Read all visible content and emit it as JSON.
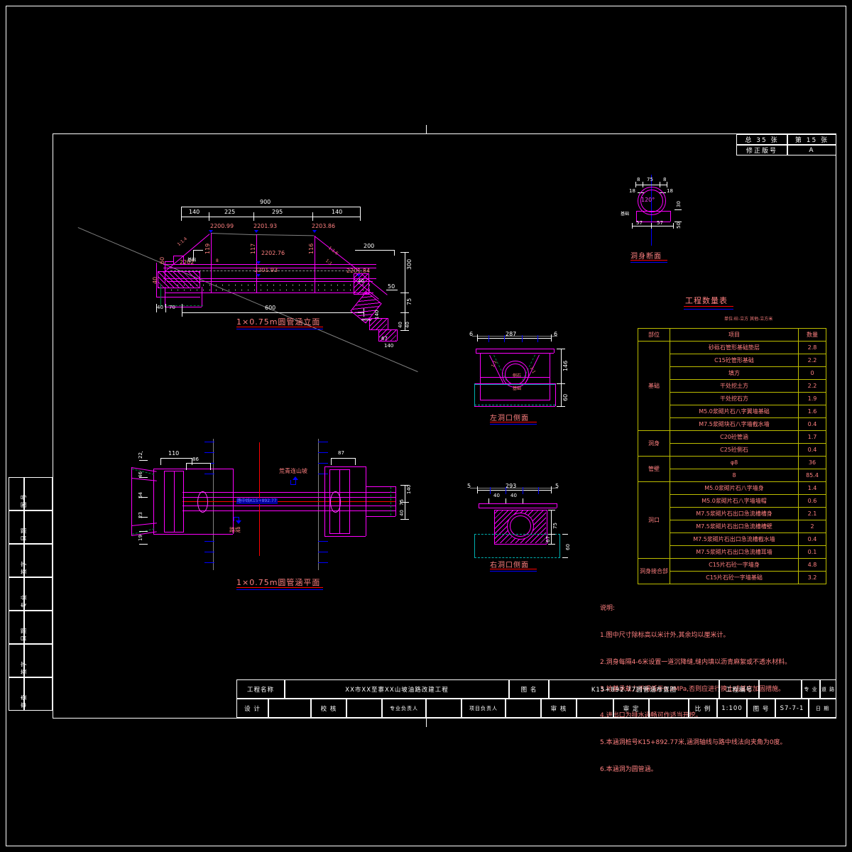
{
  "sheet": {
    "header": {
      "total_label": "总  35  张",
      "sheet_label": "第  15  张",
      "revision_label": "修正版号",
      "revision_value": "A"
    },
    "side_strip": [
      {
        "label": "图  号"
      },
      {
        "label": "日  期"
      },
      {
        "label": "签  字"
      },
      {
        "label": "专  业"
      },
      {
        "label": "日  期"
      },
      {
        "label": "签  字"
      },
      {
        "label": "审  查"
      }
    ]
  },
  "views": {
    "elevation": {
      "title": "1×0.75m圆管涵立面",
      "dims": {
        "total_top": "900",
        "seg1": "140",
        "seg2": "225",
        "seg3": "295",
        "seg4": "140",
        "bottom_total": "600",
        "left_a": "40",
        "left_b": "70",
        "left_h1": "60",
        "left_h2": "40",
        "right_200": "200",
        "right_300": "300",
        "right_50": "50",
        "right_75": "75",
        "right_40a": "40",
        "right_40b": "40",
        "right_67": "67",
        "right_140": "140",
        "right_90": "90"
      },
      "elevations": {
        "e1": "2200.99",
        "e2": "2201.93",
        "e3": "2203.86",
        "e4": "2202.76",
        "e5": "2201.93",
        "e6": "2202",
        "e7": "2201.84"
      },
      "heights": {
        "h1": "119",
        "h2": "117",
        "h3": "116"
      },
      "slopes": {
        "s1": "1:1.4",
        "s2": "1:1.6",
        "s3": "1:1"
      }
    },
    "plan": {
      "title": "1×0.75m圆管涵平面",
      "dims": {
        "d110": "110",
        "d86": "86",
        "d87": "87",
        "d22": "22",
        "d46": "46",
        "d54": "54",
        "d23": "23",
        "d19": "19",
        "r140a": "140",
        "r75": "75",
        "r40": "40"
      },
      "labels": {
        "uphill": "荒青连山坡",
        "downhill": "路堤",
        "centerline": "路中线K15+892.77"
      }
    },
    "left_inlet": {
      "title": "左洞口侧面",
      "dims": {
        "w": "287",
        "l6a": "6",
        "l6b": "6",
        "h146": "146",
        "h60": "60",
        "s1": "1:1",
        "s2": "1:1"
      }
    },
    "right_outlet": {
      "title": "右洞口侧面",
      "dims": {
        "w": "293",
        "l5a": "5",
        "l5b": "5",
        "d40a": "40",
        "d40b": "40",
        "h75": "75",
        "h67": "67",
        "h60": "60"
      }
    },
    "body_section": {
      "title": "洞身断面",
      "dims": {
        "t8a": "8",
        "w75": "75",
        "t8b": "8",
        "l18a": "18",
        "l18b": "18",
        "angle": "120°",
        "b57a": "57",
        "b57b": "57",
        "h50": "50",
        "h30": "30"
      }
    }
  },
  "quantity_table": {
    "title": "工程数量表",
    "units_note": "单位:砼-立方  其他-立方米",
    "headers": [
      "部位",
      "项目",
      "数量"
    ],
    "rows": [
      {
        "section": "基础",
        "rowspan": 7,
        "item": "砂砾石管形基础垫层",
        "qty": "2.8"
      },
      {
        "item": "C15砼管形基础",
        "qty": "2.2"
      },
      {
        "item": "填方",
        "qty": "0"
      },
      {
        "item": "干处挖土方",
        "qty": "2.2"
      },
      {
        "item": "干处挖石方",
        "qty": "1.9"
      },
      {
        "item": "M5.0浆砌片石八字翼墙基础",
        "qty": "1.6"
      },
      {
        "item": "M7.5浆砌块石八字墙截水墙",
        "qty": "0.4"
      },
      {
        "section": "洞身",
        "rowspan": 2,
        "item": "C20砼管涵",
        "qty": "1.7"
      },
      {
        "item": "C25砼侧石",
        "qty": "0.4"
      },
      {
        "section": "管壁",
        "rowspan": 2,
        "item": "φ8",
        "qty": "36"
      },
      {
        "item": "8",
        "qty": "85.4"
      },
      {
        "section": "洞口",
        "rowspan": 6,
        "item": "M5.0浆砌片石八字墙身",
        "qty": "1.4"
      },
      {
        "item": "M5.0浆砌片石八字墙墙帽",
        "qty": "0.6"
      },
      {
        "item": "M7.5浆砌片石出口急流槽槽身",
        "qty": "2.1"
      },
      {
        "item": "M7.5浆砌片石出口急流槽槽壁",
        "qty": "2"
      },
      {
        "item": "M7.5浆砌片石出口急流槽截水墙",
        "qty": "0.4"
      },
      {
        "item": "M7.5浆砌片石出口急流槽耳墙",
        "qty": "0.1"
      },
      {
        "section": "洞身接合部",
        "rowspan": 2,
        "item": "C15片石砼一字墙身",
        "qty": "4.8"
      },
      {
        "item": "C15片石砼一字墙基础",
        "qty": "3.2"
      }
    ]
  },
  "notes": {
    "heading": "说明:",
    "lines": [
      "1.图中尺寸除标高以米计外,其余均以厘米计。",
      "2.洞身每隔4-6米设置一道沉降缝,缝内填以沥青麻絮或不透水材料。",
      "3.地基承载力不得低于0.2MPa,否则应进行换土或其它加固措施。",
      "4.进出口为排水通畅可作适当开挖。",
      "5.本涵洞桩号K15+892.77米,涵洞轴线与路中线法向夹角为0度。",
      "6.本涵洞为圆管涵。"
    ]
  },
  "title_block": {
    "project_name_label": "工程名称",
    "project_name_value": "XX市XX至寨XX山坡油路改建工程",
    "drawing_name_label": "图    名",
    "drawing_name_value": "K15+892.77圆管涵布置图",
    "project_no_label": "工程编号",
    "project_no_value": "",
    "specialty_label": "专    业",
    "specialty_value": "道    路",
    "design_label": "设    计",
    "design_value": "",
    "check_label": "校    核",
    "check_value": "",
    "specialty_head_label": "专业负责人",
    "specialty_head_value": "",
    "project_head_label": "项目负责人",
    "project_head_value": "",
    "review_label": "审    核",
    "review_value": "",
    "approve_label": "审    定",
    "approve_value": "",
    "scale_label": "比    例",
    "scale_value": "1:100",
    "dwg_no_label": "图    号",
    "dwg_no_value": "S7-7-1",
    "date_label": "日    期",
    "date_value": ""
  },
  "colors": {
    "background": "#000000",
    "frame": "#ffffff",
    "geometry": "#ff00ff",
    "text_pink": "#ff8080",
    "table_grid": "#bdbd00",
    "accent_blue": "#0000ff",
    "accent_red": "#ff0000"
  }
}
